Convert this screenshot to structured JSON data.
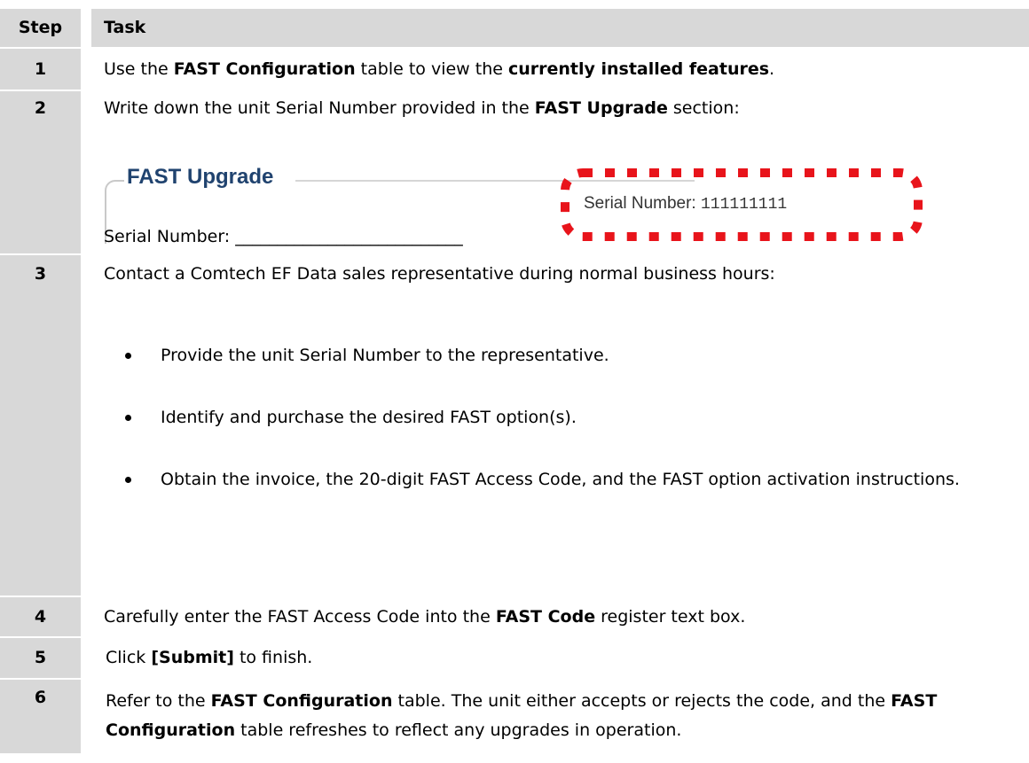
{
  "header": {
    "step": "Step",
    "task": "Task"
  },
  "rows": [
    {
      "step": "1",
      "parts": [
        "Use the ",
        "FAST Configuration",
        " table to view the ",
        "currently installed features",
        "."
      ]
    },
    {
      "step": "2",
      "parts": [
        "Write down the unit Serial Number provided in the ",
        "FAST Upgrade",
        " section:"
      ],
      "screenshot": {
        "title": "FAST Upgrade",
        "serial_label": "Serial Number:",
        "serial_value": "111111111"
      },
      "fill_in": "Serial Number: ___________________________"
    },
    {
      "step": "3",
      "intro": "Contact a Comtech EF Data sales representative during normal business hours:",
      "bullets": [
        "Provide the unit Serial Number to the representative.",
        "Identify and purchase the desired FAST option(s).",
        "Obtain the invoice, the 20-digit FAST Access Code, and the FAST option activation instructions."
      ]
    },
    {
      "step": "4",
      "parts": [
        "Carefully enter the FAST Access Code into the ",
        "FAST Code",
        " register text box."
      ]
    },
    {
      "step": "5",
      "parts": [
        "Click ",
        "[Submit]",
        " to finish."
      ]
    },
    {
      "step": "6",
      "parts": [
        "Refer to the ",
        "FAST Configuration",
        " table. The unit either accepts or rejects the code, and the ",
        "FAST Configuration",
        " table refreshes to reflect any upgrades in operation."
      ]
    }
  ],
  "colors": {
    "header_bg": "#d8d8d8",
    "step_bg": "#d8d8d8",
    "dash_red": "#e8141b",
    "fast_title": "#20436f"
  }
}
